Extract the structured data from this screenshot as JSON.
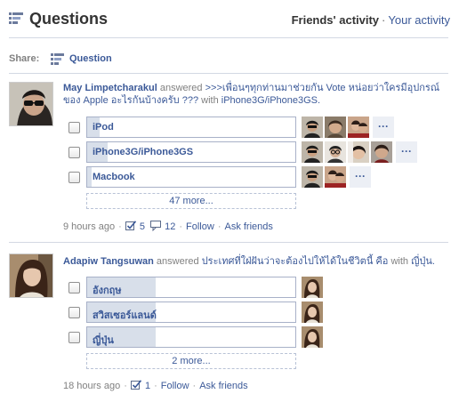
{
  "header": {
    "title": "Questions",
    "active_tab": "Friends' activity",
    "separator": "·",
    "other_tab": "Your activity"
  },
  "share": {
    "label": "Share:",
    "button": "Question"
  },
  "icons": {
    "questions": "questions-icon",
    "vote": "vote-check-icon",
    "comment": "comment-icon"
  },
  "colors": {
    "link": "#3b5998",
    "fill": "#d8dfea",
    "divider": "#d3d8e3"
  },
  "stories": [
    {
      "user": "May Limpetcharakul",
      "verb": "answered",
      "question": ">>>เพื่อนๆทุกท่านมาช่วยกัน Vote หน่อยว่าใครมีอุปกรณ์ของ Apple อะไรกันบ้างครับ ???",
      "with_word": "with",
      "answer": "iPhone3G/iPhone3GS.",
      "options": [
        {
          "label": "iPod",
          "fill": 0.06
        },
        {
          "label": "iPhone3G/iPhone3GS",
          "fill": 0.1
        },
        {
          "label": "Macbook",
          "fill": 0.02
        }
      ],
      "more_options": "47 more...",
      "more_faces": "···",
      "time": "9 hours ago",
      "votes": "5",
      "comments": "12",
      "follow": "Follow",
      "ask": "Ask friends"
    },
    {
      "user": "Adapiw Tangsuwan",
      "verb": "answered",
      "question": "ประเทศที่ใฝ่ฝันว่าจะต้องไปให้ได้ในชีวิตนี้ คือ",
      "with_word": "with",
      "answer": "ญี่ปุ่น.",
      "options": [
        {
          "label": "อังกฤษ",
          "fill": 0.33
        },
        {
          "label": "สวิสเซอร์แลนด์",
          "fill": 0.33
        },
        {
          "label": "ญี่ปุ่น",
          "fill": 0.33
        }
      ],
      "more_options": "2 more...",
      "time": "18 hours ago",
      "votes": "1",
      "follow": "Follow",
      "ask": "Ask friends"
    }
  ]
}
